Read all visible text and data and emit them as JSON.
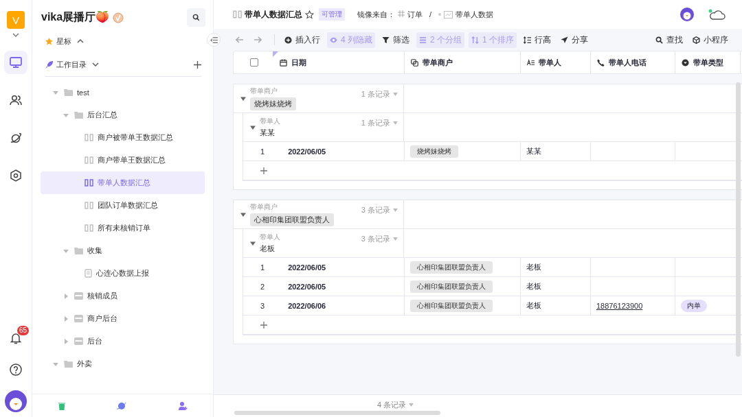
{
  "workspace": {
    "initial": "V",
    "name": "vika展播厅🍑"
  },
  "rail": {
    "notification_count": "65"
  },
  "sidebar": {
    "starred": "星标",
    "catalog": "工作目录",
    "tree": [
      {
        "kind": "folder",
        "label": "test",
        "expanded": true,
        "children": [
          {
            "kind": "folder",
            "label": "后台汇总",
            "expanded": true,
            "children": [
              {
                "kind": "sheet",
                "label": "商户被带单王数据汇总",
                "selected": false
              },
              {
                "kind": "sheet",
                "label": "商户带单王数据汇总",
                "selected": false
              },
              {
                "kind": "sheet",
                "label": "带单人数据汇总",
                "selected": true
              },
              {
                "kind": "sheet",
                "label": "团队订单数据汇总",
                "selected": false
              },
              {
                "kind": "sheet",
                "label": "所有未核销订单",
                "selected": false
              }
            ]
          },
          {
            "kind": "folder",
            "label": "收集",
            "expanded": true,
            "children": [
              {
                "kind": "form",
                "label": "心连心数据上报",
                "selected": false
              }
            ]
          },
          {
            "kind": "folder",
            "label": "核销成员",
            "expanded": false
          },
          {
            "kind": "folder",
            "label": "商户后台",
            "expanded": false
          },
          {
            "kind": "folder",
            "label": "后台",
            "expanded": false
          }
        ]
      },
      {
        "kind": "folder",
        "label": "外卖",
        "expanded": true
      }
    ]
  },
  "header": {
    "title": "带单人数据汇总",
    "permission": "可管理",
    "mirror_label": "镜像来自：",
    "source": "订单",
    "separator": "/",
    "source_view": "带单人数据"
  },
  "toolbar": {
    "items": [
      {
        "kind": "insert",
        "label": "插入行",
        "active": false
      },
      {
        "kind": "hide",
        "label": "4 列隐藏",
        "active": true
      },
      {
        "kind": "filter",
        "label": "筛选",
        "active": false
      },
      {
        "kind": "group",
        "label": "2 个分组",
        "active": true
      },
      {
        "kind": "sort",
        "label": "1 个排序",
        "active": true
      },
      {
        "kind": "height",
        "label": "行高",
        "active": false
      },
      {
        "kind": "share",
        "label": "分享",
        "active": false
      }
    ],
    "right": [
      {
        "kind": "search",
        "label": "查找"
      },
      {
        "kind": "widget",
        "label": "小程序"
      }
    ]
  },
  "table": {
    "select_all_checked": false,
    "columns": [
      {
        "kind": "date",
        "label": "日期"
      },
      {
        "kind": "link",
        "label": "带单商户"
      },
      {
        "kind": "text",
        "label": "带单人"
      },
      {
        "kind": "phone",
        "label": "带单人电话"
      },
      {
        "kind": "select",
        "label": "带单类型"
      }
    ],
    "groups": [
      {
        "field": "带单商户",
        "value": "烧烤妹烧烤",
        "count": "1 条记录",
        "expanded": true,
        "subgroups": [
          {
            "field": "带单人",
            "value": "某某",
            "count": "1 条记录",
            "expanded": true,
            "rows": [
              {
                "index": "1",
                "date": "2022/06/05",
                "merchant": "烧烤妹烧烤",
                "person": "某某"
              }
            ]
          }
        ]
      },
      {
        "field": "带单商户",
        "value": "心相印集团联盟负责人",
        "count": "3 条记录",
        "expanded": true,
        "subgroups": [
          {
            "field": "带单人",
            "value": "老板",
            "count": "3 条记录",
            "expanded": true,
            "rows": [
              {
                "index": "1",
                "date": "2022/06/05",
                "merchant": "心相印集团联盟负责人",
                "person": "老板"
              },
              {
                "index": "2",
                "date": "2022/06/05",
                "merchant": "心相印集团联盟负责人",
                "person": "老板"
              },
              {
                "index": "3",
                "date": "2022/06/06",
                "merchant": "心相印集团联盟负责人",
                "person": "老板",
                "phone": "18876123900",
                "type": "内单"
              }
            ]
          }
        ]
      }
    ]
  },
  "footer": {
    "count": "4 条记录"
  }
}
